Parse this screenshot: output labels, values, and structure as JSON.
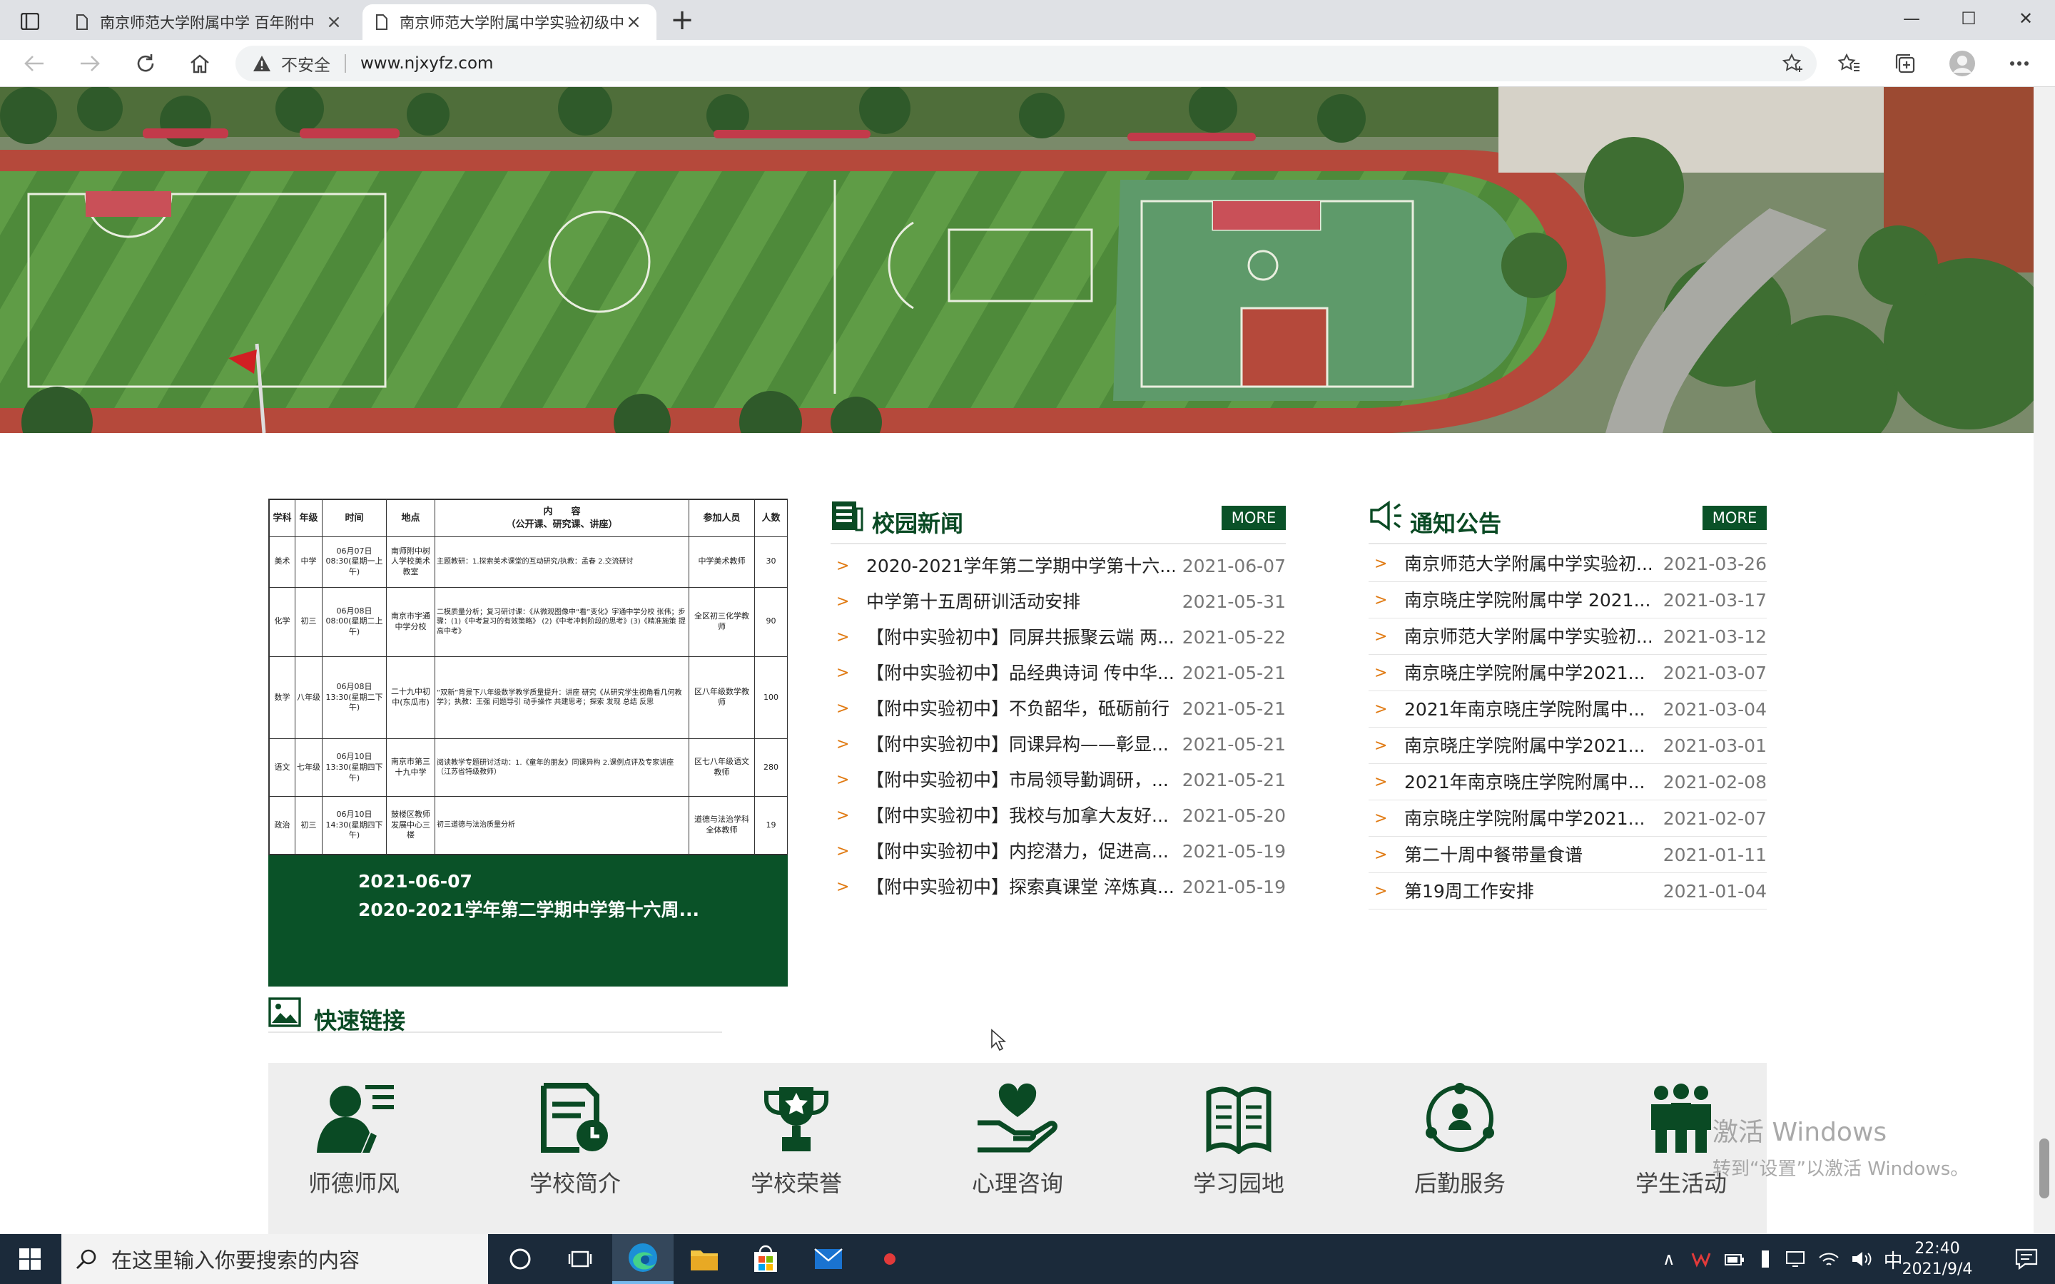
{
  "browser": {
    "tabs": [
      {
        "title": "南京师范大学附属中学 百年附中",
        "active": false
      },
      {
        "title": "南京师范大学附属中学实验初级中学",
        "active": true
      }
    ],
    "new_tab_label": "+",
    "address": {
      "security_label": "不安全",
      "url": "www.njxyfz.com"
    }
  },
  "featured": {
    "schedule": {
      "headers": [
        "学科",
        "年级",
        "时间",
        "地点",
        "内　　容\n（公开课、研究课、讲座）",
        "参加人员",
        "人数"
      ],
      "rows": [
        {
          "subject": "美术",
          "grade": "中学",
          "time": "06月07日\n08:30(星期一上午)",
          "place": "南师附中树人学校美术教室",
          "content": "主题教研：1.探索美术课堂的互动研究/执教：孟春 2.交流研讨",
          "people": "中学美术教师",
          "count": "30"
        },
        {
          "subject": "化学",
          "grade": "初三",
          "time": "06月08日\n08:00(星期二上午)",
          "place": "南京市宇通中学分校",
          "content": "二模质量分析；复习研讨课：《从微观图像中“看”变化》宇通中学分校 张伟；步骤：(1)《中考复习的有效策略》 (2)《中考冲刺阶段的思考》(3)《精准施策 提高中考》",
          "people": "全区初三化学教师",
          "count": "90"
        },
        {
          "subject": "数学",
          "grade": "八年级",
          "time": "06月08日\n13:30(星期二下午)",
          "place": "二十九中初中(东瓜市)",
          "content": "“双新”背景下八年级数学教学质量提升：讲座 研究《从研究学生视角看几何教学》；执教：王强 问题导引 动手操作 共建思考；探索 发现 总结 反思",
          "people": "区八年级数学教师",
          "count": "100"
        },
        {
          "subject": "语文",
          "grade": "七年级",
          "time": "06月10日\n13:30(星期四下午)",
          "place": "南京市第三十九中学",
          "content": "阅读教学专题研讨活动：1.《童年的朋友》同课异构 2.课例点评及专家讲座（江苏省特级教师）",
          "people": "区七八年级语文教师",
          "count": "280"
        },
        {
          "subject": "政治",
          "grade": "初三",
          "time": "06月10日\n14:30(星期四下午)",
          "place": "鼓楼区教师发展中心三楼",
          "content": "初三道德与法治质量分析",
          "people": "道德与法治学科全体教师",
          "count": "19"
        }
      ]
    },
    "caption": {
      "date": "2021-06-07",
      "title": "2020-2021学年第二学期中学第十六周..."
    }
  },
  "campus_news": {
    "heading": "校园新闻",
    "more_label": "MORE",
    "chevron": ">",
    "items": [
      {
        "title": "2020-2021学年第二学期中学第十六...",
        "date": "2021-06-07"
      },
      {
        "title": "中学第十五周研训活动安排",
        "date": "2021-05-31"
      },
      {
        "title": "【附中实验初中】同屏共振聚云端 两...",
        "date": "2021-05-22"
      },
      {
        "title": "【附中实验初中】品经典诗词 传中华...",
        "date": "2021-05-21"
      },
      {
        "title": "【附中实验初中】不负韶华，砥砺前行",
        "date": "2021-05-21"
      },
      {
        "title": "【附中实验初中】同课异构——彰显...",
        "date": "2021-05-21"
      },
      {
        "title": "【附中实验初中】市局领导勤调研，...",
        "date": "2021-05-21"
      },
      {
        "title": "【附中实验初中】我校与加拿大友好...",
        "date": "2021-05-20"
      },
      {
        "title": "【附中实验初中】内挖潜力，促进高...",
        "date": "2021-05-19"
      },
      {
        "title": "【附中实验初中】探索真课堂 淬炼真...",
        "date": "2021-05-19"
      }
    ]
  },
  "notices": {
    "heading": "通知公告",
    "more_label": "MORE",
    "chevron": ">",
    "items": [
      {
        "title": "南京师范大学附属中学实验初...",
        "date": "2021-03-26"
      },
      {
        "title": "南京晓庄学院附属中学 2021...",
        "date": "2021-03-17"
      },
      {
        "title": "南京师范大学附属中学实验初...",
        "date": "2021-03-12"
      },
      {
        "title": "南京晓庄学院附属中学2021...",
        "date": "2021-03-07"
      },
      {
        "title": "2021年南京晓庄学院附属中...",
        "date": "2021-03-04"
      },
      {
        "title": "南京晓庄学院附属中学2021...",
        "date": "2021-03-01"
      },
      {
        "title": "2021年南京晓庄学院附属中...",
        "date": "2021-02-08"
      },
      {
        "title": "南京晓庄学院附属中学2021...",
        "date": "2021-02-07"
      },
      {
        "title": "第二十周中餐带量食谱",
        "date": "2021-01-11"
      },
      {
        "title": "第19周工作安排",
        "date": "2021-01-04"
      }
    ]
  },
  "quick_links": {
    "heading": "快速链接",
    "items": [
      {
        "label": "师德师风",
        "icon": "teacher-icon"
      },
      {
        "label": "学校简介",
        "icon": "document-clock-icon"
      },
      {
        "label": "学校荣誉",
        "icon": "trophy-icon"
      },
      {
        "label": "心理咨询",
        "icon": "heart-hand-icon"
      },
      {
        "label": "学习园地",
        "icon": "book-icon"
      },
      {
        "label": "后勤服务",
        "icon": "people-network-icon"
      },
      {
        "label": "学生活动",
        "icon": "group-icon"
      }
    ]
  },
  "watermark": {
    "line1": "激活 Windows",
    "line2": "转到“设置”以激活 Windows。"
  },
  "taskbar": {
    "search_placeholder": "在这里输入你要搜索的内容",
    "ime": "中",
    "time": "22:40",
    "date": "2021/9/4"
  },
  "colors": {
    "brand_green": "#0a5228",
    "heading_green": "#0a4a24",
    "chevron_orange": "#e07a12"
  }
}
